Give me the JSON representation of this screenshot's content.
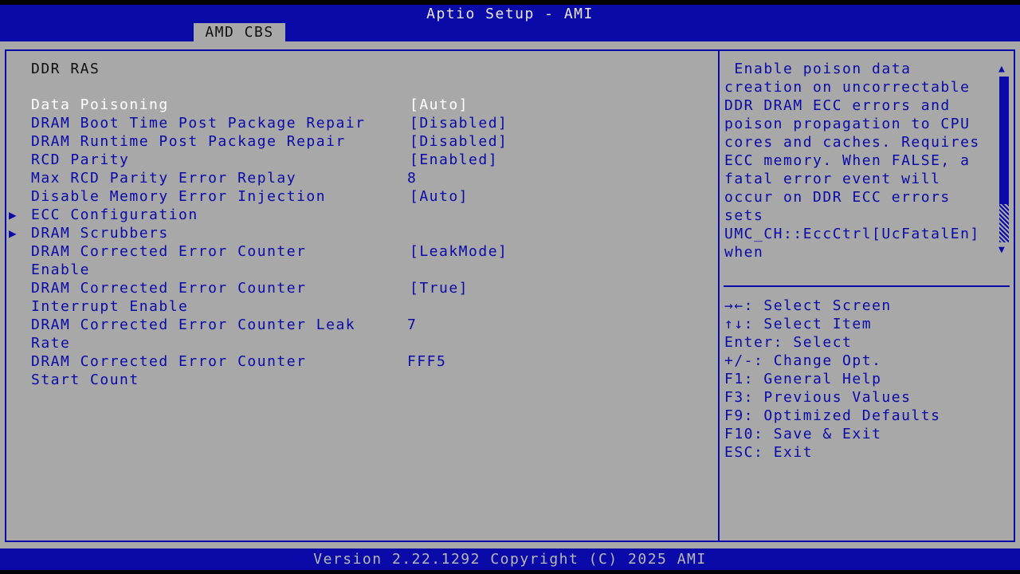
{
  "header": {
    "title": "Aptio Setup - AMI",
    "tab": "AMD CBS"
  },
  "section_title": "DDR RAS",
  "settings": [
    {
      "label": "Data Poisoning",
      "value": "[Auto]"
    },
    {
      "label": "DRAM Boot Time Post Package Repair",
      "value": "[Disabled]"
    },
    {
      "label": "DRAM Runtime Post Package Repair",
      "value": "[Disabled]"
    },
    {
      "label": "RCD Parity",
      "value": "[Enabled]"
    },
    {
      "label": "Max RCD Parity Error Replay",
      "value": "8"
    },
    {
      "label": "Disable Memory Error Injection",
      "value": "[Auto]"
    },
    {
      "label": "ECC Configuration",
      "submenu": true
    },
    {
      "label": "DRAM Scrubbers",
      "submenu": true
    },
    {
      "label": "DRAM Corrected Error Counter",
      "label2": "Enable",
      "value": "[LeakMode]"
    },
    {
      "label": "DRAM Corrected Error Counter",
      "label2": "Interrupt Enable",
      "value": "[True]"
    },
    {
      "label": "DRAM Corrected Error Counter Leak",
      "label2": "Rate",
      "value": "7"
    },
    {
      "label": "DRAM Corrected Error Counter",
      "label2": "Start Count",
      "value": "FFF5"
    }
  ],
  "help": {
    "lines": [
      " Enable poison data",
      "creation on uncorrectable",
      "DDR DRAM ECC errors and",
      "poison propagation to CPU",
      "cores and caches. Requires",
      "ECC memory. When FALSE, a",
      "fatal error event will",
      "occur on DDR ECC errors",
      "sets",
      "UMC_CH::EccCtrl[UcFatalEn]",
      "when"
    ]
  },
  "keys": [
    {
      "key": "→←:",
      "desc": "Select Screen"
    },
    {
      "key": "↑↓:",
      "desc": "Select Item"
    },
    {
      "key": "Enter:",
      "desc": "Select"
    },
    {
      "key": "+/-:",
      "desc": "Change Opt."
    },
    {
      "key": "F1:",
      "desc": "General Help"
    },
    {
      "key": "F3:",
      "desc": "Previous Values"
    },
    {
      "key": "F9:",
      "desc": "Optimized Defaults"
    },
    {
      "key": "F10:",
      "desc": "Save & Exit"
    },
    {
      "key": "ESC:",
      "desc": "Exit"
    }
  ],
  "footer": "Version 2.22.1292 Copyright (C) 2025 AMI",
  "colors": {
    "bios_blue": "#0a0aa8",
    "panel_gray": "#a8a8a8",
    "highlight_white": "#ffffff"
  }
}
